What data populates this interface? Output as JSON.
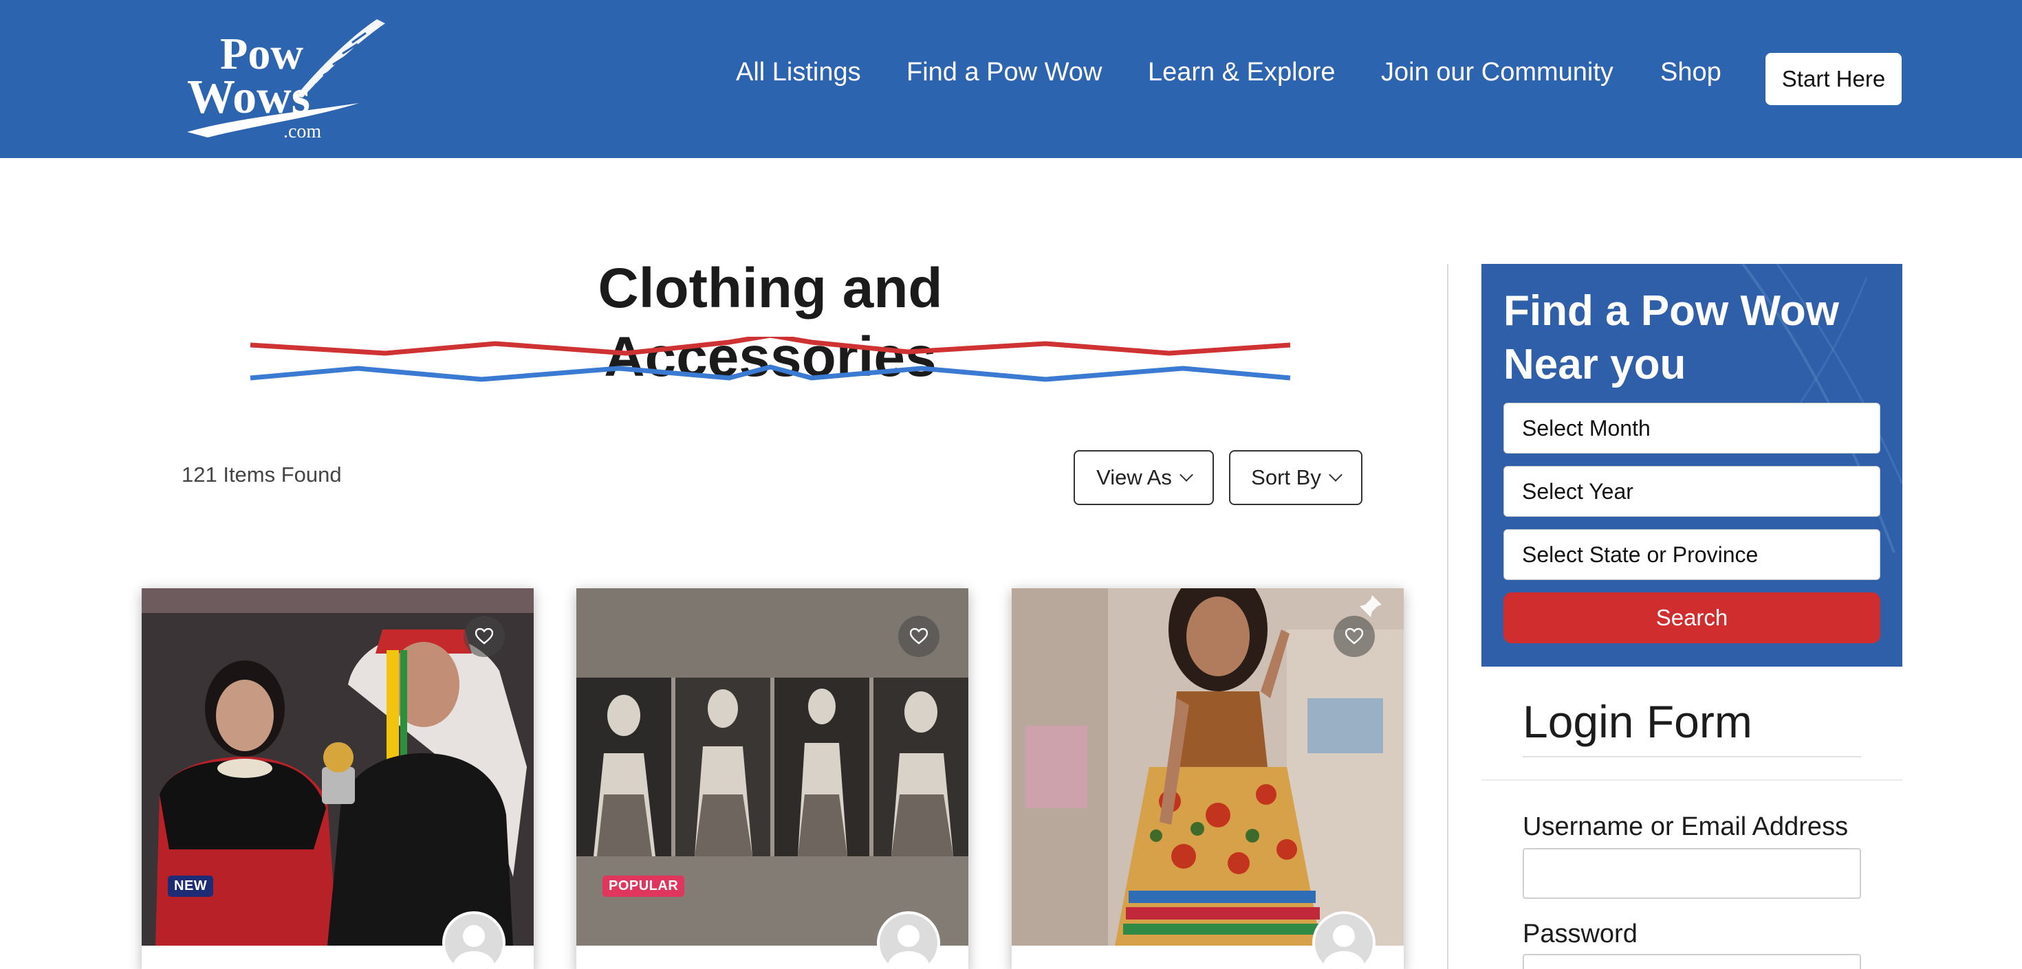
{
  "header": {
    "logo": {
      "line1": "Pow",
      "line2": "Wows",
      "suffix": ".com"
    },
    "nav": [
      "All Listings",
      "Find a Pow Wow",
      "Learn & Explore",
      "Join our Community",
      "Shop"
    ],
    "cta": "Start Here",
    "colors": {
      "bar": "#2d64b0"
    }
  },
  "main": {
    "title": "Clothing and Accessories",
    "items_found": "121 Items Found",
    "view_as": "View As",
    "sort_by": "Sort By",
    "divider_colors": {
      "top": "#cf3232",
      "bottom": "#3b7ad3"
    }
  },
  "cards": [
    {
      "badge": "NEW",
      "badge_type": "new",
      "icons": [
        "heart-icon",
        "user-icon"
      ]
    },
    {
      "badge": "POPULAR",
      "badge_type": "popular",
      "icons": [
        "heart-icon",
        "user-icon"
      ]
    },
    {
      "badge": "",
      "badge_type": "",
      "icons": [
        "heart-icon",
        "pin-icon",
        "user-icon"
      ]
    }
  ],
  "sidebar": {
    "finder": {
      "title_line1": "Find a Pow Wow",
      "title_line2": "Near you",
      "month": "Select Month",
      "year": "Select Year",
      "state": "Select State or Province",
      "search": "Search",
      "colors": {
        "panel": "#2e5fa8",
        "button": "#d02e2e"
      }
    },
    "login": {
      "title": "Login Form",
      "username_label": "Username or Email Address",
      "password_label": "Password"
    }
  }
}
